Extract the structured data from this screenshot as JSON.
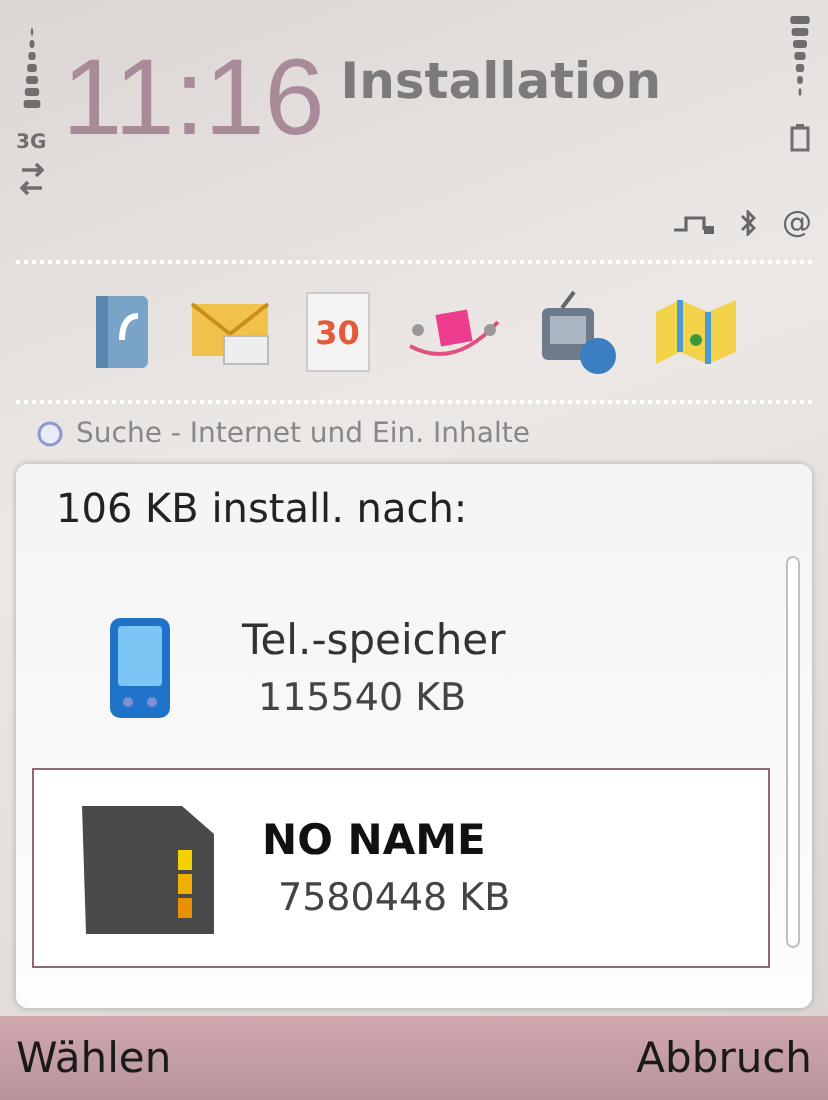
{
  "status_bar": {
    "network": "3G",
    "clock": "11:16",
    "title": "Installation",
    "indicator": "@"
  },
  "shortcuts": [
    {
      "kind": "contacts"
    },
    {
      "kind": "mail"
    },
    {
      "kind": "calendar",
      "label": "30"
    },
    {
      "kind": "web"
    },
    {
      "kind": "media"
    },
    {
      "kind": "maps"
    }
  ],
  "search": {
    "placeholder": "Suche - Internet und Ein. Inhalte"
  },
  "dialog": {
    "heading": "106 KB install. nach:",
    "items": [
      {
        "kind": "phone",
        "name": "Tel.-speicher",
        "free": "115540 KB",
        "selected": false
      },
      {
        "kind": "card",
        "name": "NO NAME",
        "free": "7580448 KB",
        "selected": true
      }
    ]
  },
  "softkeys": {
    "left": "Wählen",
    "right": "Abbruch"
  }
}
